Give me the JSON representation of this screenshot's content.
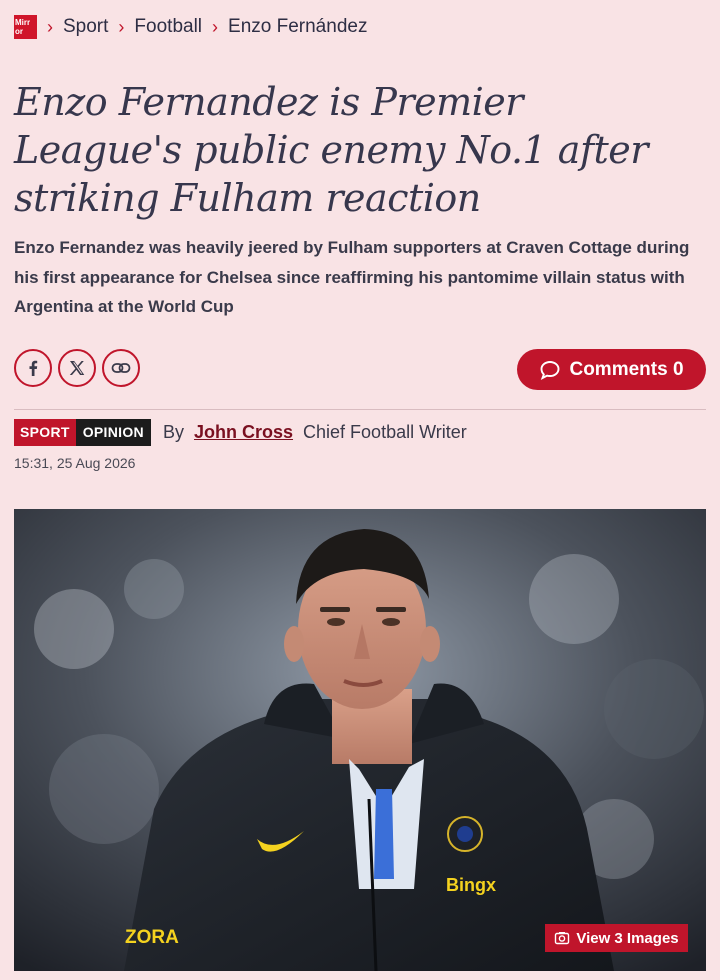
{
  "breadcrumb": {
    "logo_text_1": "Mirr",
    "logo_text_2": "or",
    "items": [
      "Sport",
      "Football",
      "Enzo Fernández"
    ]
  },
  "article": {
    "headline": "Enzo Fernandez is Premier League's public enemy No.1 after striking Fulham reaction",
    "standfirst": "Enzo Fernandez was heavily jeered by Fulham supporters at Craven Cottage during his first appearance for Chelsea since reaffirming his pantomime villain status with Argentina at the World Cup",
    "tags": [
      "SPORT",
      "OPINION"
    ],
    "by_label": "By",
    "author": "John Cross",
    "author_role": "Chief Football Writer",
    "timestamp": "15:31, 25 Aug 2026"
  },
  "share": {
    "icons": [
      "facebook-icon",
      "x-icon",
      "link-icon"
    ]
  },
  "comments": {
    "label": "Comments 0"
  },
  "hero": {
    "view_images_label": "View 3 Images",
    "shirt_sponsor": "Bingx",
    "sleeve_text": "ZORA"
  },
  "colors": {
    "background": "#f9e3e5",
    "accent": "#c0152b",
    "opinion_tag": "#1c1c1c",
    "text": "#2b2b3a"
  }
}
